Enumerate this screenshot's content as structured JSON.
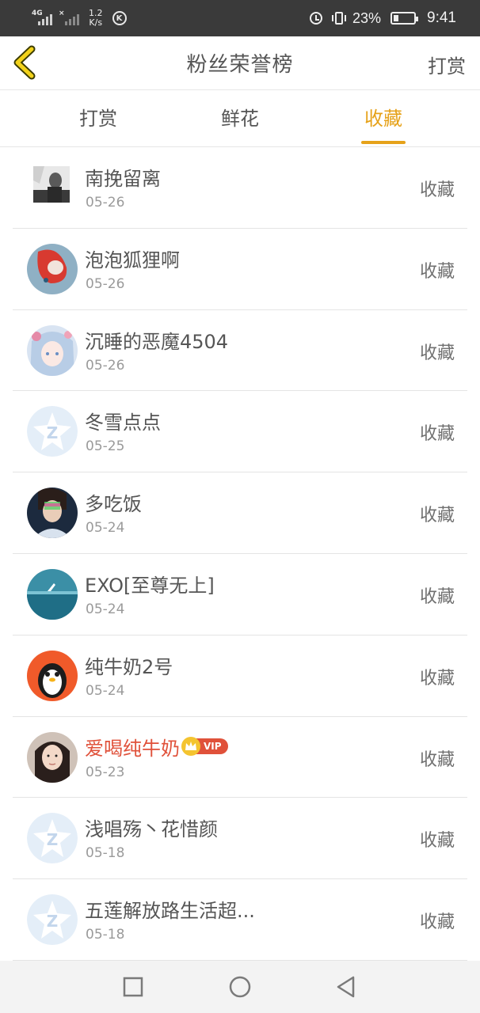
{
  "status_bar": {
    "network": "4G",
    "speed_value": "1.2",
    "speed_unit": "K/s",
    "k_icon": "K",
    "battery_percent": "23%",
    "time": "9:41"
  },
  "header": {
    "title": "粉丝荣誉榜",
    "action_label": "打赏"
  },
  "tabs": [
    {
      "label": "打赏",
      "active": false
    },
    {
      "label": "鲜花",
      "active": false
    },
    {
      "label": "收藏",
      "active": true
    }
  ],
  "fans": [
    {
      "name": "南挽留离",
      "date": "05-26",
      "action": "收藏",
      "avatar": "photo-grayscale"
    },
    {
      "name": "泡泡狐狸啊",
      "date": "05-26",
      "action": "收藏",
      "avatar": "photo-red-fox"
    },
    {
      "name": "沉睡的恶魔4504",
      "date": "05-26",
      "action": "收藏",
      "avatar": "photo-anime-girl"
    },
    {
      "name": "冬雪点点",
      "date": "05-25",
      "action": "收藏",
      "avatar": "default-star"
    },
    {
      "name": "多吃饭",
      "date": "05-24",
      "action": "收藏",
      "avatar": "photo-boy"
    },
    {
      "name": "EXO[至尊无上]",
      "date": "05-24",
      "action": "收藏",
      "avatar": "photo-sea"
    },
    {
      "name": "纯牛奶2号",
      "date": "05-24",
      "action": "收藏",
      "avatar": "photo-penguin"
    },
    {
      "name": "爱喝纯牛奶",
      "date": "05-23",
      "action": "收藏",
      "avatar": "photo-girl",
      "vip": true,
      "vip_label": "VIP"
    },
    {
      "name": "浅唱殇丶花惜颜",
      "date": "05-18",
      "action": "收藏",
      "avatar": "default-star"
    },
    {
      "name": "五莲解放路生活超...",
      "date": "05-18",
      "action": "收藏",
      "avatar": "default-star"
    }
  ],
  "colors": {
    "accent": "#e6a21a",
    "vip_name": "#e0513a",
    "text": "#555555",
    "muted": "#9a9a9a"
  },
  "system_nav": {
    "icons": [
      "square-recent-icon",
      "circle-home-icon",
      "triangle-back-icon"
    ]
  }
}
